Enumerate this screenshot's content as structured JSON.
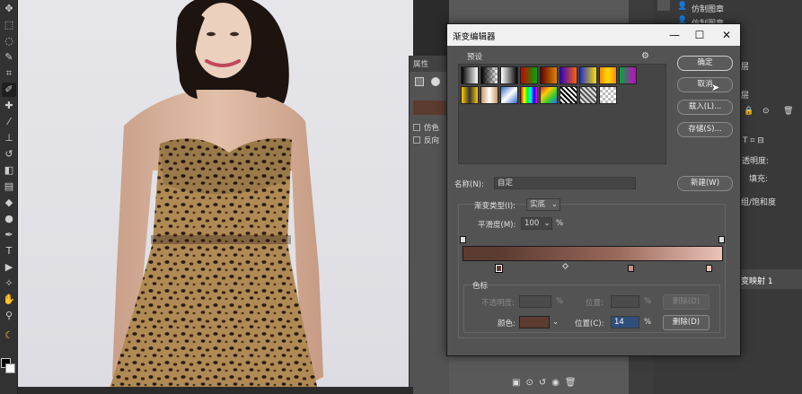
{
  "dialog": {
    "title": "渐变编辑器",
    "presets_label": "预设",
    "ok": "确定",
    "cancel": "取消",
    "load": "载入(L)...",
    "save": "存储(S)...",
    "name_label": "名称(N):",
    "name_value": "自定",
    "new_button": "新建(W)",
    "gradient_type_label": "渐变类型(I):",
    "gradient_type_value": "实底",
    "smoothness_label": "平滑度(M):",
    "smoothness_value": "100",
    "percent": "%",
    "stops_group_label": "色标",
    "opacity_label": "不透明度:",
    "location_label_top": "位置:",
    "delete_top": "删除(D)",
    "color_label": "颜色:",
    "location_label": "位置(C):",
    "location_value": "14",
    "delete_bottom": "删除(D)",
    "gear_icon": "gear-icon",
    "current_stop_color": "#5c3b30",
    "gradient_start": "#5c3b30",
    "gradient_end": "#ebc3b7"
  },
  "properties_panel": {
    "title": "属性",
    "dither": "仿色",
    "reverse": "反向"
  },
  "layers_panel": {
    "items": [
      "仿制图章",
      "仿制图章"
    ],
    "partial_labels": [
      "层",
      "层",
      "组/饱和度",
      "变映射 1"
    ],
    "opacity_partial": "透明度:",
    "fill_partial": "填充:"
  }
}
